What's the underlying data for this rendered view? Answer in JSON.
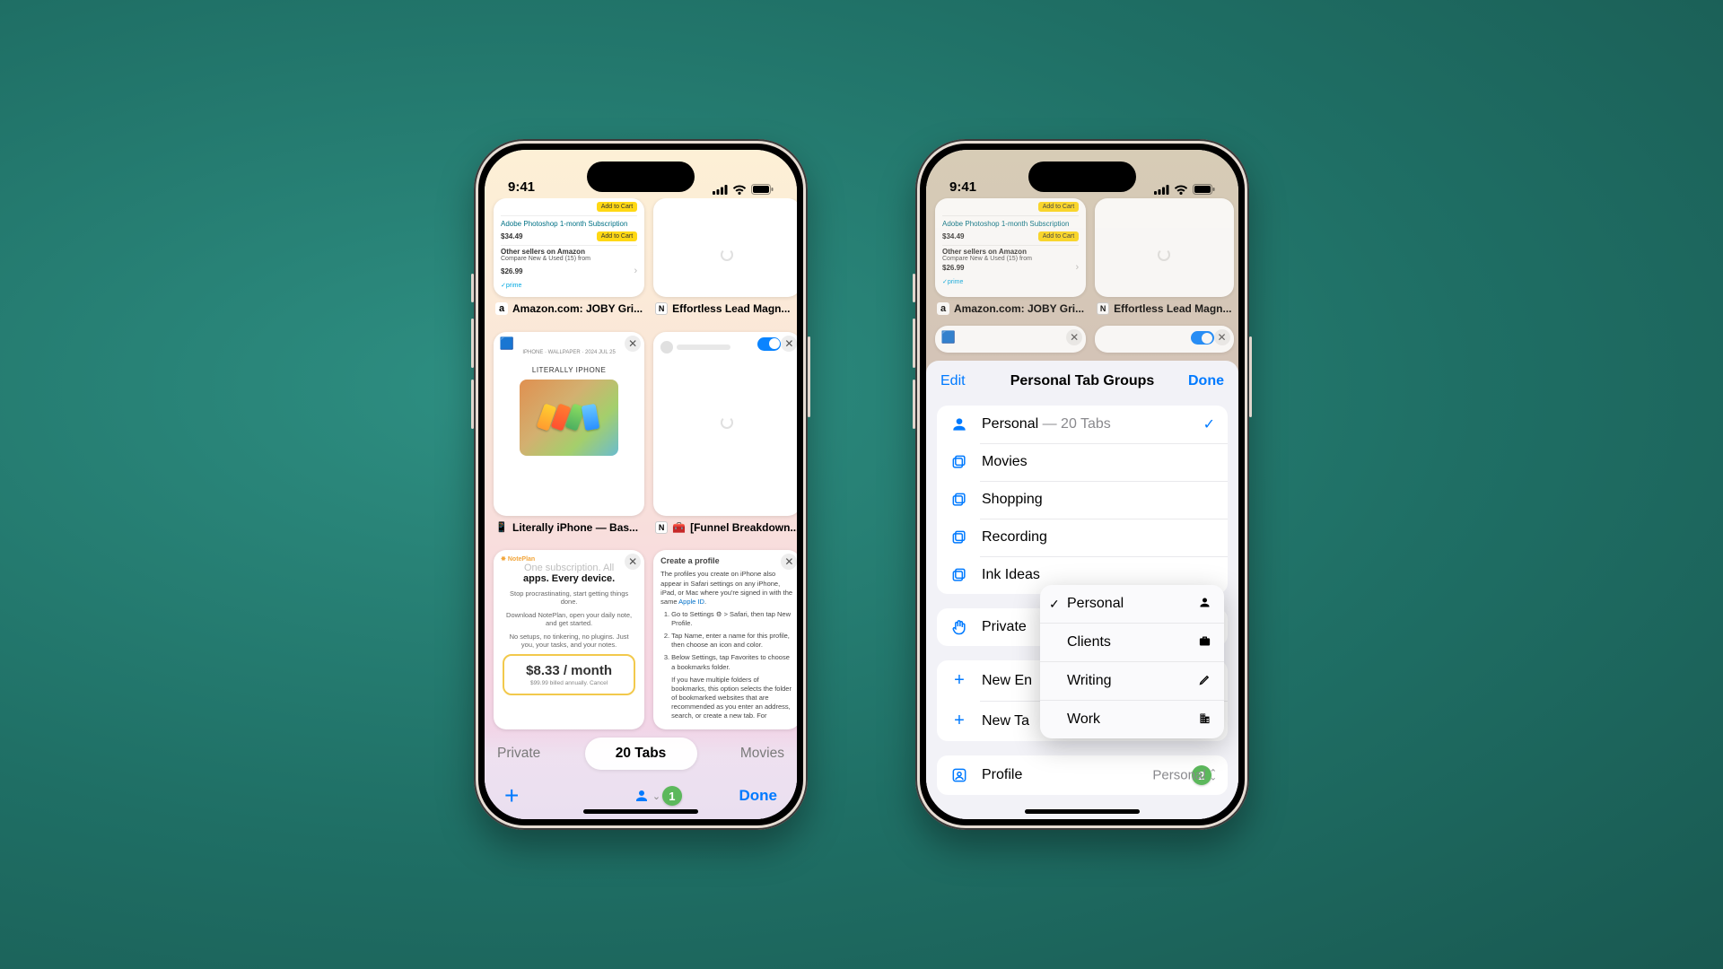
{
  "statusbar": {
    "time": "9:41"
  },
  "colors": {
    "ios_blue": "#007aff",
    "badge_green": "#5cb85c"
  },
  "screen1": {
    "tabs": [
      {
        "label": "Amazon.com: JOBY Gri...",
        "favicon": "a",
        "card": {
          "link": "Adobe Photoshop 1-month Subscription",
          "price": "$34.49",
          "btn": "Add to Cart",
          "sellers_head": "Other sellers on Amazon",
          "compare": "Compare New & Used (15) from",
          "price2": "$26.99",
          "prime": "✓prime"
        }
      },
      {
        "label": "Effortless Lead Magn...",
        "favicon": "N"
      },
      {
        "label": "Literally iPhone — Bas...",
        "favicon": "📱",
        "card": {
          "sub": "IPHONE · WALLPAPER · 2024 JUL 25",
          "title": "LITERALLY IPHONE"
        }
      },
      {
        "label": "[Funnel Breakdown...",
        "favicon": "N",
        "icon_prefix": "🧰"
      },
      {
        "label_hidden": true,
        "card": {
          "badge": "NotePlan",
          "head_light": "One subscription. All",
          "head_bold": "apps. Every device.",
          "p1": "Stop procrastinating, start getting things done.",
          "p2": "Download NotePlan, open your daily note, and get started.",
          "p3": "No setups, no tinkering, no plugins. Just you, your tasks, and your notes.",
          "price": "$8.33 / month",
          "note": "$99.99 billed annually. Cancel"
        }
      },
      {
        "label_hidden": true,
        "card": {
          "title": "Create a profile",
          "intro": "The profiles you create on iPhone also appear in Safari settings on any iPhone, iPad, or Mac where you're signed in with the same ",
          "link": "Apple ID",
          "li1": "Go to Settings ⚙︎ > Safari, then tap New Profile.",
          "li2": "Tap Name, enter a name for this profile, then choose an icon and color.",
          "li3": "Below Settings, tap Favorites to choose a bookmarks folder.",
          "li4": "If you have multiple folders of bookmarks, this option selects the folder of bookmarked websites that are recommended as you enter an address, search, or create a new tab. For"
        }
      }
    ],
    "segments": {
      "left": "Private",
      "mid": "20 Tabs",
      "right": "Movies"
    },
    "done": "Done",
    "badge": "1"
  },
  "screen2": {
    "bg_tabs": [
      {
        "label": "Amazon.com: JOBY Gri...",
        "favicon": "a"
      },
      {
        "label": "Effortless Lead Magn...",
        "favicon": "N"
      }
    ],
    "sheet": {
      "edit": "Edit",
      "title": "Personal Tab Groups",
      "done": "Done",
      "groups": [
        {
          "icon": "person",
          "name": "Personal",
          "sub": " — 20 Tabs",
          "checked": true
        },
        {
          "icon": "stack",
          "name": "Movies"
        },
        {
          "icon": "stack",
          "name": "Shopping"
        },
        {
          "icon": "stack",
          "name": "Recording"
        },
        {
          "icon": "stack",
          "name": "Ink Ideas"
        }
      ],
      "private_label": "Private",
      "actions": [
        {
          "name": "New Empty Tab Group",
          "visible": "New En"
        },
        {
          "name": "New Tab Group",
          "visible": "New Ta"
        }
      ],
      "profile": {
        "label": "Profile",
        "selected": "Personal"
      },
      "badge": "2"
    },
    "popup": [
      {
        "name": "Personal",
        "checked": true,
        "icon": "person"
      },
      {
        "name": "Clients",
        "icon": "briefcase"
      },
      {
        "name": "Writing",
        "icon": "pencil"
      },
      {
        "name": "Work",
        "icon": "building"
      }
    ]
  }
}
